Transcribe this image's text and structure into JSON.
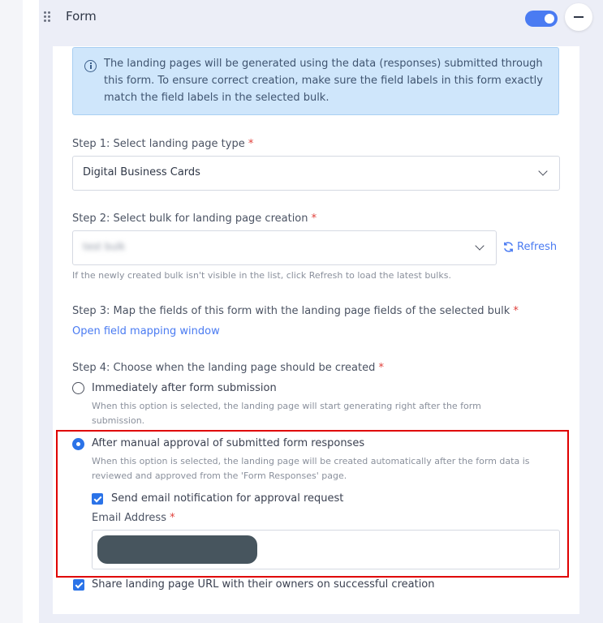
{
  "header": {
    "title": "Form",
    "toggle_state": "on",
    "accent_color": "#4a7bf2"
  },
  "info": {
    "text": "The landing pages will be generated using the data (responses) submitted through this form. To ensure correct creation, make sure the field labels in this form exactly match the field labels in the selected bulk.",
    "icon": "info-icon"
  },
  "step1": {
    "label": "Step 1: Select landing page type",
    "required_mark": "*",
    "selected": "Digital Business Cards"
  },
  "step2": {
    "label": "Step 2: Select bulk for landing page creation",
    "required_mark": "*",
    "selected_blurred": "test bulk",
    "refresh_label": "Refresh",
    "hint": "If the newly created bulk isn't visible in the list, click Refresh to load the latest bulks."
  },
  "step3": {
    "label": "Step 3: Map the fields of this form with the landing page fields of the selected bulk",
    "required_mark": "*",
    "link": "Open field mapping window"
  },
  "step4": {
    "label": "Step 4: Choose when the landing page should be created",
    "required_mark": "*",
    "options": [
      {
        "label": "Immediately after form submission",
        "description": "When this option is selected, the landing page will start generating right after the form submission.",
        "selected": false
      },
      {
        "label": "After manual approval of submitted form responses",
        "description": "When this option is selected, the landing page will be created automatically after the form data is reviewed and approved from the 'Form Responses' page.",
        "selected": true
      }
    ],
    "email_notification_label": "Send email notification for approval request",
    "email_notification_checked": true,
    "email_label": "Email Address",
    "email_required_mark": "*",
    "email_value_redacted": true
  },
  "share": {
    "label": "Share landing page URL with their owners on successful creation",
    "checked": true
  },
  "highlight_color": "#e00000"
}
